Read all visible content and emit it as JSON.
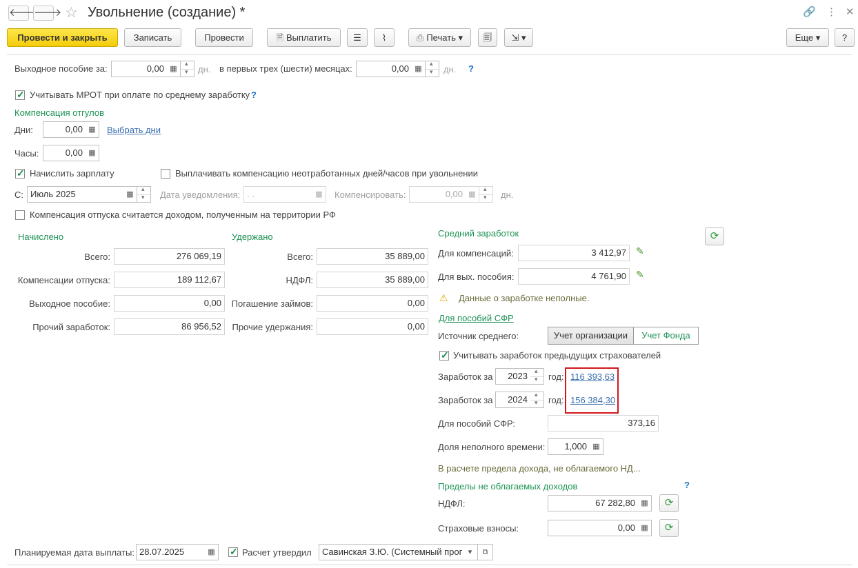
{
  "window": {
    "title": "Увольнение (создание) *"
  },
  "toolbar": {
    "post_close": "Провести и закрыть",
    "save": "Записать",
    "post": "Провести",
    "pay": "Выплатить",
    "print": "Печать",
    "more": "Еще",
    "help": "?"
  },
  "severance": {
    "label": "Выходное пособие за:",
    "value": "0,00",
    "unit": "дн.",
    "first_months_label": "в первых трех (шести) месяцах:",
    "first_months_value": "0,00",
    "first_months_unit": "дн.",
    "help": "?"
  },
  "mrot": {
    "label": "Учитывать МРОТ при оплате по среднему заработку",
    "checked": true,
    "help": "?"
  },
  "vacation_comp": {
    "header": "Компенсация отгулов",
    "days_label": "Дни:",
    "days_value": "0,00",
    "select_days": "Выбрать дни",
    "hours_label": "Часы:",
    "hours_value": "0,00"
  },
  "salary": {
    "accrue_label": "Начислить зарплату",
    "accrue_checked": true,
    "pay_comp_label": "Выплачивать компенсацию неотработанных дней/часов при увольнении",
    "pay_comp_checked": false,
    "from_label": "С:",
    "from_value": "Июль 2025",
    "notice_date_label": "Дата уведомления:",
    "notice_date_value": " .  .",
    "compensate_label": "Компенсировать:",
    "compensate_value": "0,00",
    "compensate_unit": "дн."
  },
  "vacation_income": {
    "label": "Компенсация отпуска считается доходом, полученным на территории РФ",
    "checked": false
  },
  "accrued": {
    "header": "Начислено",
    "rows": [
      {
        "label": "Всего:",
        "value": "276 069,19"
      },
      {
        "label": "Компенсации отпуска:",
        "value": "189 112,67"
      },
      {
        "label": "Выходное пособие:",
        "value": "0,00"
      },
      {
        "label": "Прочий заработок:",
        "value": "86 956,52"
      }
    ]
  },
  "withheld": {
    "header": "Удержано",
    "rows": [
      {
        "label": "Всего:",
        "value": "35 889,00"
      },
      {
        "label": "НДФЛ:",
        "value": "35 889,00"
      },
      {
        "label": "Погашение займов:",
        "value": "0,00"
      },
      {
        "label": "Прочие удержания:",
        "value": "0,00"
      }
    ]
  },
  "average": {
    "header": "Средний заработок",
    "compensation_label": "Для компенсаций:",
    "compensation_value": "3 412,97",
    "severance_label": "Для вых. пособия:",
    "severance_value": "4 761,90",
    "warning": "Данные о заработке неполные.",
    "sfr_link": "Для пособий СФР",
    "source_label": "Источник среднего:",
    "source_org": "Учет организации",
    "source_fund": "Учет Фонда",
    "prev_insurers_label": "Учитывать заработок предыдущих страхователей",
    "prev_insurers_checked": true,
    "earnings": [
      {
        "label": "Заработок за",
        "year": "2023",
        "suffix": "год:",
        "amount": "116 393,63"
      },
      {
        "label": "Заработок за",
        "year": "2024",
        "suffix": "год:",
        "amount": "156 384,30"
      }
    ],
    "sfr_label": "Для пособий СФР:",
    "sfr_value": "373,16",
    "part_time_label": "Доля неполного времени:",
    "part_time_value": "1,000",
    "note": "В расчете предела дохода, не облагаемого НД...",
    "limits_header": "Пределы не облагаемых доходов",
    "limits_help": "?",
    "ndfl_label": "НДФЛ:",
    "ndfl_value": "67 282,80",
    "insurance_label": "Страховые взносы:",
    "insurance_value": "0,00"
  },
  "footer": {
    "pay_date_label": "Планируемая дата выплаты:",
    "pay_date_value": "28.07.2025",
    "approved_label": "Расчет утвердил",
    "approved_checked": true,
    "approver": "Савинская З.Ю. (Системный прог"
  },
  "colors": {
    "accent_yellow": "#f4cc0b",
    "group_green": "#1d9255",
    "link_blue": "#3a6fb0",
    "highlight_red": "#d3161c"
  }
}
